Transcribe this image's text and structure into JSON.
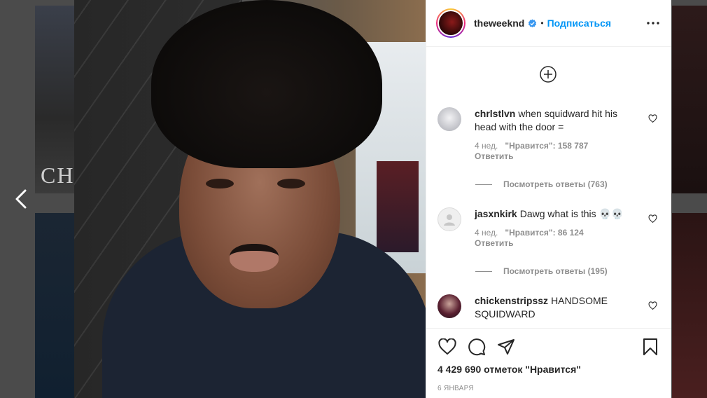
{
  "post": {
    "username": "theweeknd",
    "follow_label": "Подписаться",
    "separator": "•",
    "likes_total": "4 429 690 отметок \"Нравится\"",
    "date": "6 января"
  },
  "comments": [
    {
      "username": "chrlstlvn",
      "text": "when squidward hit his head with the door =",
      "age": "4 нед.",
      "likes": "\"Нравится\": 158 787",
      "reply_label": "Ответить",
      "view_replies": "Посмотреть ответы (763)",
      "avatar_color": "#d8d8dc"
    },
    {
      "username": "jasxnkirk",
      "text": "Dawg what is this 💀💀",
      "age": "4 нед.",
      "likes": "\"Нравится\": 86 124",
      "reply_label": "Ответить",
      "view_replies": "Посмотреть ответы (195)",
      "avatar_color": "#efefef"
    },
    {
      "username": "chickenstripssz",
      "text": "HANDSOME SQUIDWARD",
      "avatar_color": "#3a1f2a"
    }
  ],
  "icons": {
    "prev": "chevron-left-icon",
    "verified": "verified-badge-icon",
    "more": "more-options-icon",
    "load_more": "plus-circle-icon",
    "like": "heart-icon",
    "comment": "comment-icon",
    "share": "paper-plane-icon",
    "save": "bookmark-icon"
  },
  "colors": {
    "accent": "#0095f6",
    "text": "#262626",
    "muted": "#8e8e8e"
  }
}
